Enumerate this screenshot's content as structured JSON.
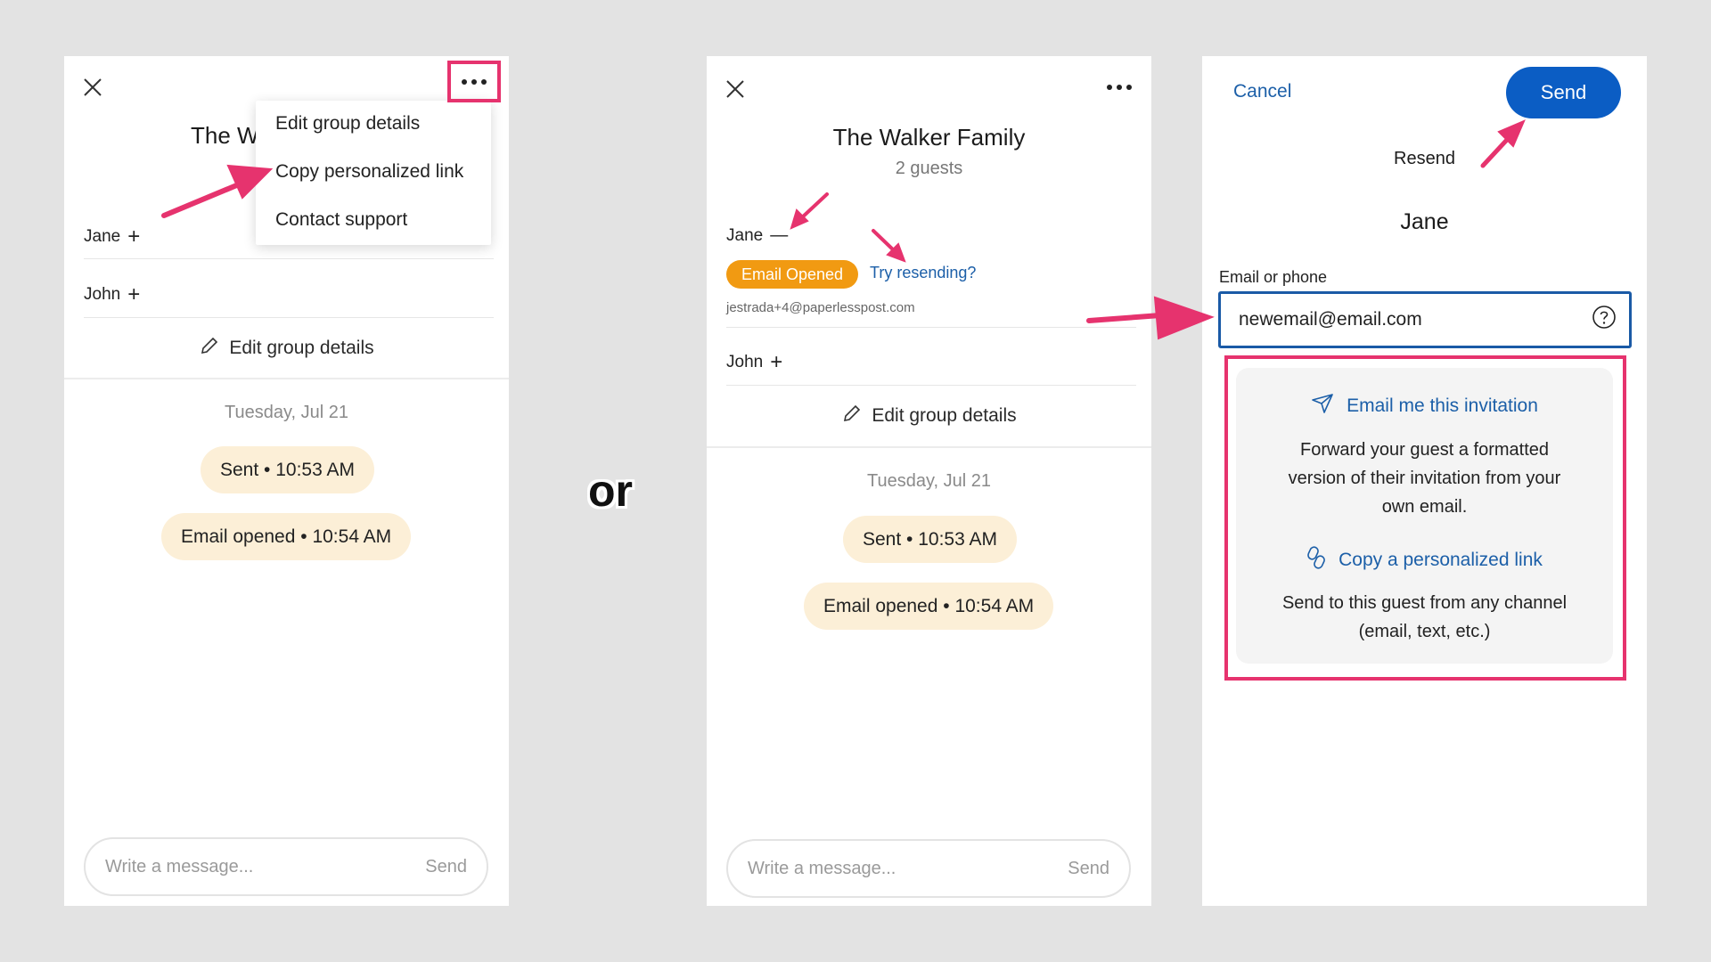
{
  "colors": {
    "accent_pink": "#e6336e",
    "link_blue": "#1c5fa8",
    "primary_button": "#0b5dc4",
    "badge_orange": "#f19a12",
    "pill_bg": "#fcefd7"
  },
  "separator": "or",
  "panel1": {
    "title_partial": "The W",
    "guests": [
      {
        "name": "Jane",
        "toggle": "+"
      },
      {
        "name": "John",
        "toggle": "+"
      }
    ],
    "edit_group": "Edit group details",
    "date": "Tuesday, Jul 21",
    "events": [
      "Sent • 10:53 AM",
      "Email opened • 10:54 AM"
    ],
    "message_placeholder": "Write a message...",
    "send": "Send",
    "menu": {
      "icon": "more-dots-icon",
      "items": [
        "Edit group details",
        "Copy personalized link",
        "Contact support"
      ]
    }
  },
  "panel2": {
    "title": "The Walker Family",
    "guest_count": "2 guests",
    "guests": [
      {
        "name": "Jane",
        "toggle": "—",
        "status": "Email Opened",
        "resend_link": "Try resending?",
        "email": "jestrada+4@paperlesspost.com"
      },
      {
        "name": "John",
        "toggle": "+"
      }
    ],
    "edit_group": "Edit group details",
    "date": "Tuesday, Jul 21",
    "events": [
      "Sent • 10:53 AM",
      "Email opened • 10:54 AM"
    ],
    "message_placeholder": "Write a message...",
    "send": "Send"
  },
  "panel3": {
    "cancel": "Cancel",
    "send_button": "Send",
    "heading": "Resend",
    "guest_name": "Jane",
    "field_label": "Email or phone",
    "field_value": "newemail@email.com",
    "options": [
      {
        "icon": "paper-plane-icon",
        "title": "Email me this invitation",
        "desc_lines": [
          "Forward your guest a formatted",
          "version of their invitation from your",
          "own email."
        ]
      },
      {
        "icon": "link-icon",
        "title": "Copy a personalized link",
        "desc_lines": [
          "Send to this guest from any channel",
          "(email, text, etc.)"
        ]
      }
    ]
  }
}
